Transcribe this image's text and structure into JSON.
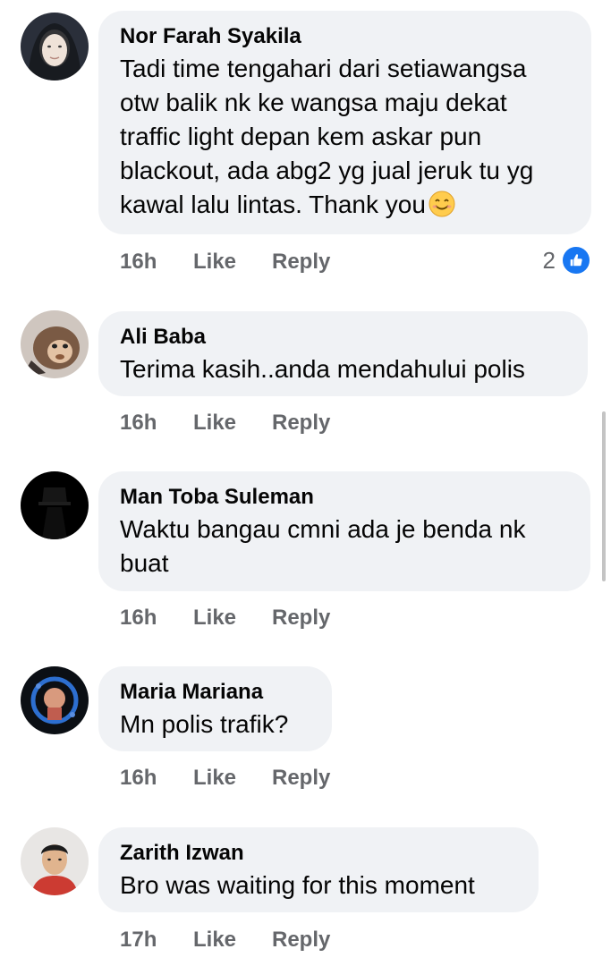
{
  "comments": [
    {
      "author": "Nor Farah Syakila",
      "text_lines": [
        "Tadi time tengahari dari setiawangsa",
        "otw balik nk ke wangsa maju dekat",
        "traffic light depan kem askar pun",
        "blackout, ada abg2 yg jual jeruk tu yg",
        "kawal lalu lintas. Thank you"
      ],
      "emoji": "smiling-face-emoji",
      "time": "16h",
      "like_label": "Like",
      "reply_label": "Reply",
      "reaction_count": "2",
      "reaction_icon": "like-reaction-icon"
    },
    {
      "author": "Ali Baba",
      "text_lines": [
        "Terima kasih..anda mendahului polis"
      ],
      "time": "16h",
      "like_label": "Like",
      "reply_label": "Reply"
    },
    {
      "author": "Man Toba Suleman",
      "text_lines": [
        "Waktu bangau cmni ada je benda nk",
        "buat"
      ],
      "time": "16h",
      "like_label": "Like",
      "reply_label": "Reply"
    },
    {
      "author": "Maria Mariana",
      "text_lines": [
        "Mn polis trafik?"
      ],
      "time": "16h",
      "like_label": "Like",
      "reply_label": "Reply"
    },
    {
      "author": "Zarith Izwan",
      "text_lines": [
        "Bro was waiting for this moment"
      ],
      "time": "17h",
      "like_label": "Like",
      "reply_label": "Reply"
    }
  ],
  "colors": {
    "bubble_bg": "#f0f2f5",
    "secondary_text": "#65676b",
    "like_blue": "#1877f2"
  }
}
